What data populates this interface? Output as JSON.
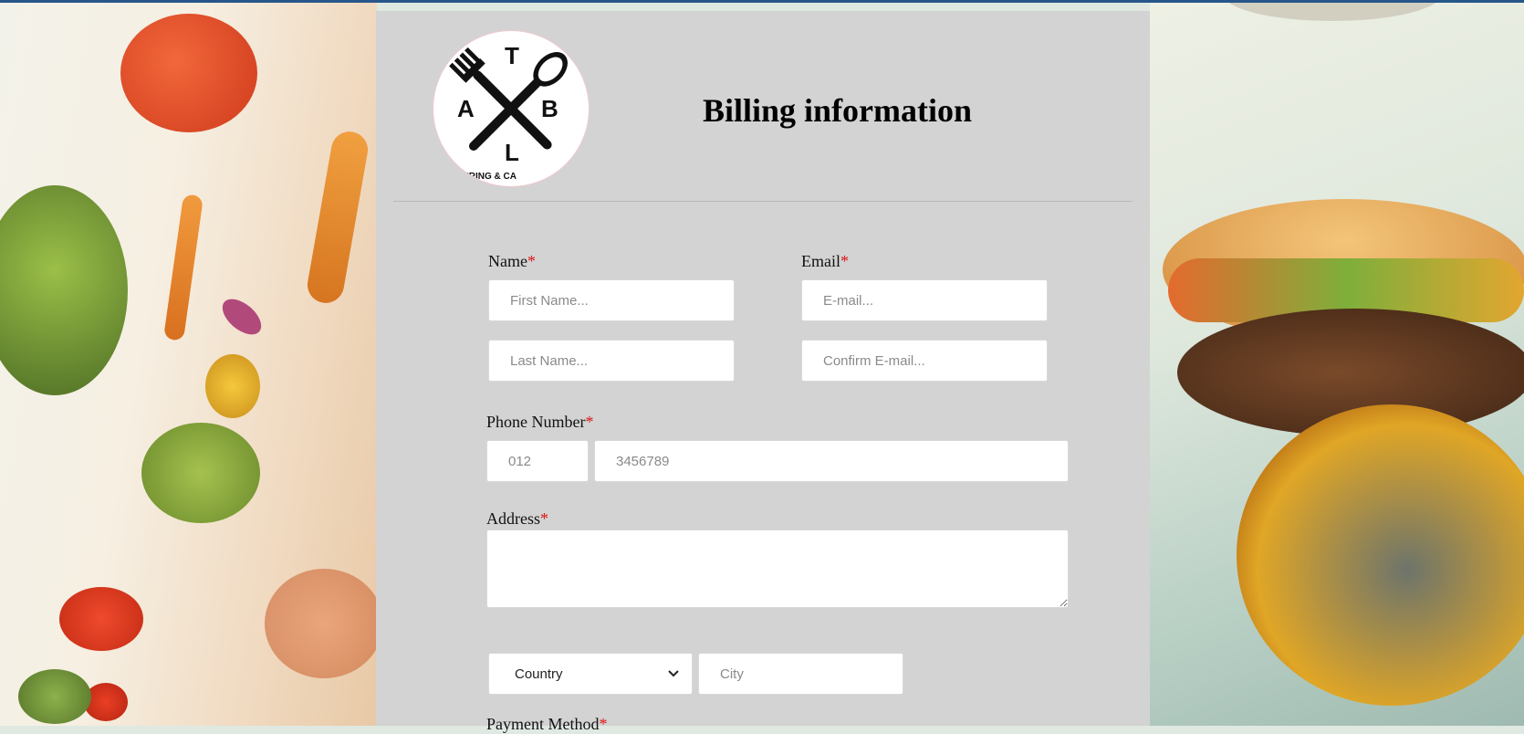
{
  "form": {
    "title": "Billing information",
    "logo": {
      "letters": [
        "T",
        "A",
        "B",
        "L"
      ],
      "tagline": "TERING & CA"
    },
    "name": {
      "label": "Name",
      "required_mark": "*",
      "first_placeholder": "First Name...",
      "last_placeholder": "Last Name..."
    },
    "email": {
      "label": "Email",
      "required_mark": "*",
      "placeholder": "E-mail...",
      "confirm_placeholder": "Confirm E-mail..."
    },
    "phone": {
      "label": "Phone Number",
      "required_mark": "*",
      "prefix_placeholder": "012",
      "number_placeholder": "3456789"
    },
    "address": {
      "label": "Address",
      "required_mark": "*"
    },
    "location": {
      "country_selected": "Country",
      "city_placeholder": "City"
    },
    "payment": {
      "label": "Payment Method",
      "required_mark": "*"
    }
  },
  "colors": {
    "card_background": "#d3d3d3",
    "required": "#e01515",
    "top_bar": "#27568a"
  }
}
